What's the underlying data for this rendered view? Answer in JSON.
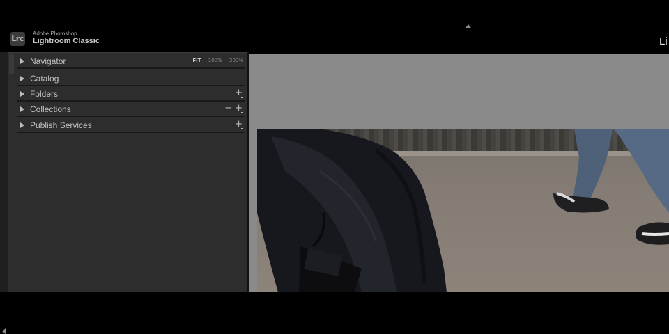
{
  "app": {
    "brand_line1": "Adobe Photoshop",
    "brand_line2": "Lightroom Classic",
    "logo_text": "Lrc",
    "module_label": "Li"
  },
  "left_panel": {
    "sections": [
      {
        "label": "Navigator"
      },
      {
        "label": "Catalog"
      },
      {
        "label": "Folders"
      },
      {
        "label": "Collections"
      },
      {
        "label": "Publish Services"
      }
    ],
    "navigator_zoom_options": [
      "FIT",
      "100%",
      "200%"
    ],
    "add_symbol": "+",
    "remove_symbol": "−"
  },
  "colors": {
    "panel_bg": "#2d2d2d",
    "main_bg": "#8a8a8a",
    "topbar_bg": "#000000"
  }
}
